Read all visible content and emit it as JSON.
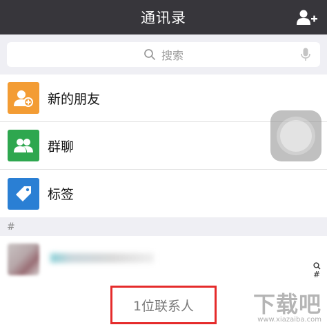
{
  "navbar": {
    "title": "通讯录",
    "add_contact_icon": "add-person-icon"
  },
  "search": {
    "placeholder": "搜索",
    "search_icon": "search-icon",
    "mic_icon": "microphone-icon"
  },
  "menu_items": [
    {
      "label": "新的朋友",
      "icon": "new-friend-icon",
      "color": "#f39c34"
    },
    {
      "label": "群聊",
      "icon": "group-chat-icon",
      "color": "#2ea74f"
    },
    {
      "label": "标签",
      "icon": "tag-icon",
      "color": "#2a7fd4"
    }
  ],
  "section": {
    "header": "#"
  },
  "index_bar": {
    "items": [
      "#"
    ],
    "search_icon": "search-icon"
  },
  "contact": {
    "avatar_icon": "avatar-blurred"
  },
  "footer": {
    "count_label": "1位联系人"
  },
  "watermark": {
    "logo": "下载吧",
    "url": "www.xiazaiba.com"
  },
  "colors": {
    "navbar_bg": "#37363b",
    "highlight_border": "#e52b2b",
    "background": "#efeff4"
  }
}
